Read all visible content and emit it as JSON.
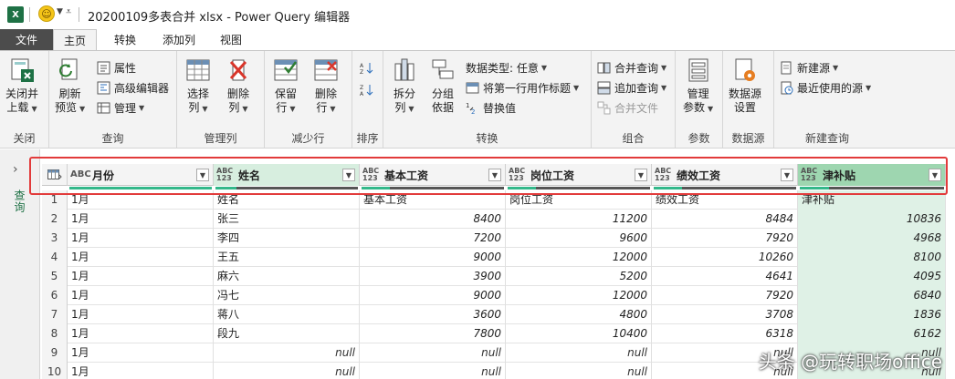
{
  "window": {
    "title": "20200109多表合并 xlsx - Power Query 编辑器"
  },
  "tabs": [
    {
      "label": "文件"
    },
    {
      "label": "主页"
    },
    {
      "label": "转换"
    },
    {
      "label": "添加列"
    },
    {
      "label": "视图"
    }
  ],
  "ribbon": {
    "groups": {
      "close": "关闭",
      "query": "查询",
      "manage_columns": "管理列",
      "reduce_rows": "减少行",
      "sort": "排序",
      "transform": "转换",
      "combine": "组合",
      "parameters": "参数",
      "data_source": "数据源",
      "new_query": "新建查询"
    },
    "close_apply": {
      "line1": "关闭并",
      "line2": "上载"
    },
    "refresh_preview": {
      "line1": "刷新",
      "line2": "预览"
    },
    "properties": "属性",
    "advanced_editor": "高级编辑器",
    "manage": "管理",
    "choose_columns": {
      "line1": "选择",
      "line2": "列"
    },
    "remove_columns": {
      "line1": "删除",
      "line2": "列"
    },
    "keep_rows": {
      "line1": "保留",
      "line2": "行"
    },
    "remove_rows": {
      "line1": "删除",
      "line2": "行"
    },
    "split_column": {
      "line1": "拆分",
      "line2": "列"
    },
    "group_by": {
      "line1": "分组",
      "line2": "依据"
    },
    "data_type": "数据类型: 任意",
    "first_row_header": "将第一行用作标题",
    "replace_values": "替换值",
    "merge_queries": "合并查询",
    "append_queries": "追加查询",
    "combine_files": "合并文件",
    "manage_params": {
      "line1": "管理",
      "line2": "参数"
    },
    "ds_settings": {
      "line1": "数据源",
      "line2": "设置"
    },
    "new_source": "新建源",
    "recent_sources": "最近使用的源"
  },
  "rail": {
    "label": "查询"
  },
  "columns": [
    {
      "type": "ABC",
      "name": "月份"
    },
    {
      "type": "ABC\n123",
      "name": "姓名"
    },
    {
      "type": "ABC\n123",
      "name": "基本工资"
    },
    {
      "type": "ABC\n123",
      "name": "岗位工资"
    },
    {
      "type": "ABC\n123",
      "name": "绩效工资"
    },
    {
      "type": "ABC\n123",
      "name": "津补贴"
    }
  ],
  "rows": [
    {
      "n": "1",
      "c": [
        "1月",
        "姓名",
        "基本工资",
        "岗位工资",
        "绩效工资",
        "津补贴"
      ]
    },
    {
      "n": "2",
      "c": [
        "1月",
        "张三",
        "8400",
        "11200",
        "8484",
        "10836"
      ]
    },
    {
      "n": "3",
      "c": [
        "1月",
        "李四",
        "7200",
        "9600",
        "7920",
        "4968"
      ]
    },
    {
      "n": "4",
      "c": [
        "1月",
        "王五",
        "9000",
        "12000",
        "10260",
        "8100"
      ]
    },
    {
      "n": "5",
      "c": [
        "1月",
        "麻六",
        "3900",
        "5200",
        "4641",
        "4095"
      ]
    },
    {
      "n": "6",
      "c": [
        "1月",
        "冯七",
        "9000",
        "12000",
        "7920",
        "6840"
      ]
    },
    {
      "n": "7",
      "c": [
        "1月",
        "蒋八",
        "3600",
        "4800",
        "3708",
        "1836"
      ]
    },
    {
      "n": "8",
      "c": [
        "1月",
        "段九",
        "7800",
        "10400",
        "6318",
        "6162"
      ]
    },
    {
      "n": "9",
      "c": [
        "1月",
        "null",
        "null",
        "null",
        "null",
        "null"
      ]
    },
    {
      "n": "10",
      "c": [
        "1月",
        "null",
        "null",
        "null",
        "null",
        "null"
      ]
    }
  ],
  "watermark": "头条 @玩转职场office"
}
